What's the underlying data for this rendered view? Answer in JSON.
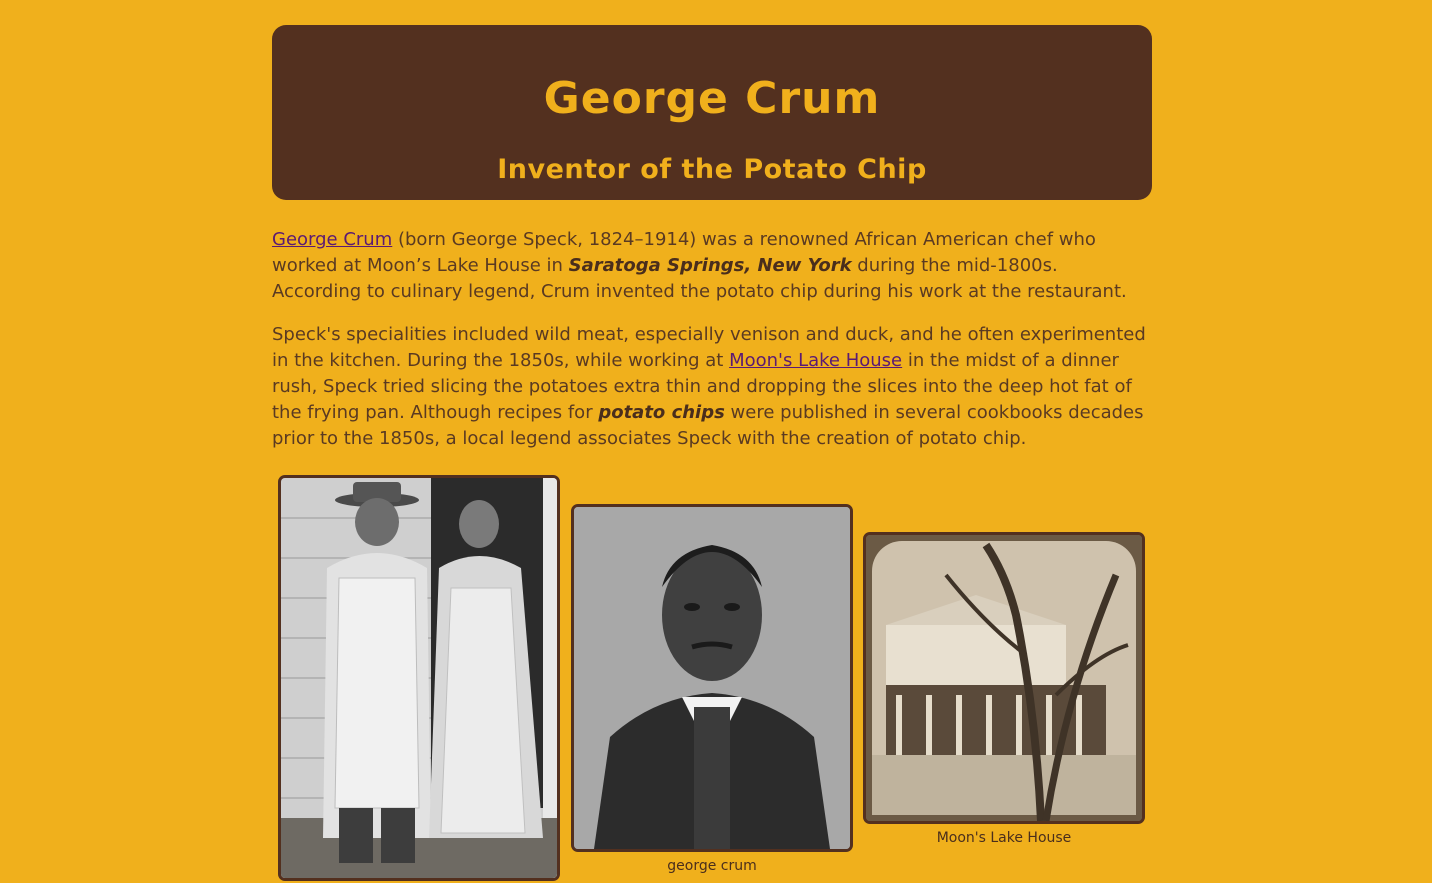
{
  "header": {
    "title": "George Crum",
    "subtitle": "Inventor of the Potato Chip"
  },
  "article": {
    "p1": {
      "link": "George Crum",
      "text_a": " (born George Speck, 1824–1914) was a renowned African American chef who worked at Moon’s Lake House in ",
      "bold": "Saratoga Springs, New York",
      "text_b": " during the mid-1800s. According to culinary legend, Crum invented the potato chip during his work at the restaurant."
    },
    "p2": {
      "text_a": "Speck's specialities included wild meat, especially venison and duck, and he often experimented in the kitchen. During the 1850s, while working at ",
      "link": "Moon's Lake House",
      "text_b": " in the midst of a dinner rush, Speck tried slicing the potatoes extra thin and dropping the slices into the deep hot fat of the frying pan. Although recipes for ",
      "bold": "potato chips",
      "text_c": " were published in several cookbooks decades prior to the 1850s, a local legend associates Speck with the creation of potato chip."
    }
  },
  "gallery": [
    {
      "caption": ""
    },
    {
      "caption": "george crum"
    },
    {
      "caption": "Moon's Lake House"
    }
  ],
  "colors": {
    "background": "#f0b01c",
    "banner": "#53301f",
    "link": "#5b1a73"
  }
}
